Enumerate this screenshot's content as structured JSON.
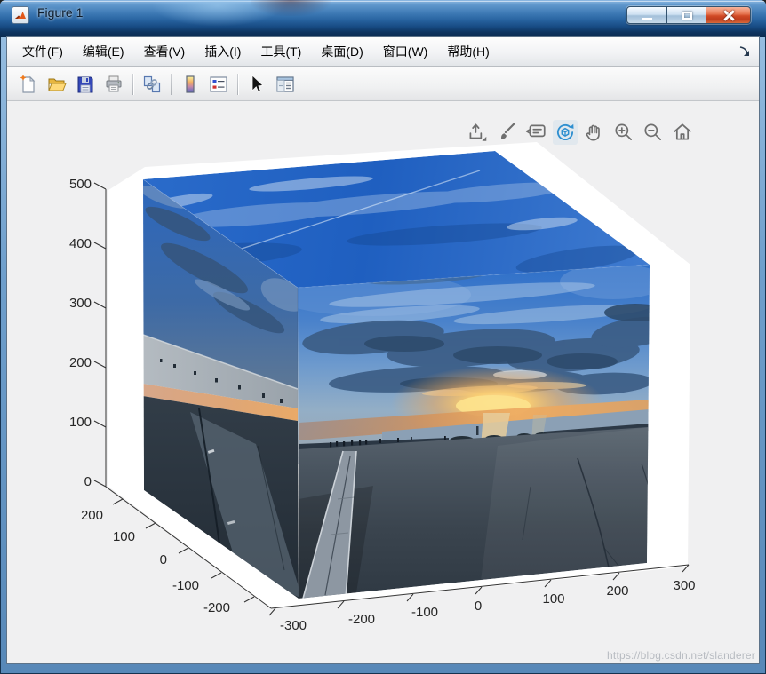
{
  "window": {
    "title": "Figure 1",
    "app_icon": "matlab-logo-icon",
    "controls": {
      "minimize": "minimize",
      "maximize": "maximize",
      "close": "close"
    }
  },
  "menu_bar": {
    "items": [
      "文件(F)",
      "编辑(E)",
      "查看(V)",
      "插入(I)",
      "工具(T)",
      "桌面(D)",
      "窗口(W)",
      "帮助(H)"
    ],
    "dock_icon": "dock-arrow-icon"
  },
  "toolbar": {
    "buttons": [
      "new-figure",
      "open-file",
      "save-figure",
      "print-figure",
      "link-plot",
      "insert-colorbar",
      "insert-legend",
      "edit-plot",
      "property-inspector"
    ]
  },
  "axes_toolbar": {
    "buttons": [
      "export",
      "brush-data",
      "data-tips",
      "rotate-3d",
      "pan",
      "zoom-in",
      "zoom-out",
      "restore-view"
    ],
    "active": "rotate-3d"
  },
  "chart_data": {
    "type": "3d-surface-image",
    "description": "Panoramic seaside sunset photograph texture-mapped onto the faces of a 3D cube (skybox) displayed in MATLAB axes; rotate-3d mode active",
    "x_axis": {
      "ticks": [
        "-300",
        "-200",
        "-100",
        "0",
        "100",
        "200",
        "300"
      ],
      "range": [
        -300,
        300
      ]
    },
    "y_axis": {
      "ticks": [
        "200",
        "100",
        "0",
        "-100",
        "-200"
      ],
      "range": [
        -250,
        250
      ]
    },
    "z_axis": {
      "ticks": [
        "0",
        "100",
        "200",
        "300",
        "400",
        "500"
      ],
      "range": [
        0,
        500
      ]
    },
    "grid": false,
    "legend": false,
    "view": "3d view, azimuth about -37 deg, elevation about 30 deg"
  },
  "watermark": {
    "text": "https://blog.csdn.net/slanderer"
  },
  "colors": {
    "titlebar_blue": "#2a6cb0",
    "figure_background": "#f0f0f1",
    "axes_pane_white": "#ffffff",
    "sky_deep_blue": "#2463c4",
    "cloud_slate": "#3b5c84",
    "sunset_orange": "#eeac62",
    "sun_glow": "#ffe9a8",
    "ground_slate": "#3a444e",
    "close_button_red": "#d14a26",
    "rotate_active_blue": "#2e8fd0"
  }
}
